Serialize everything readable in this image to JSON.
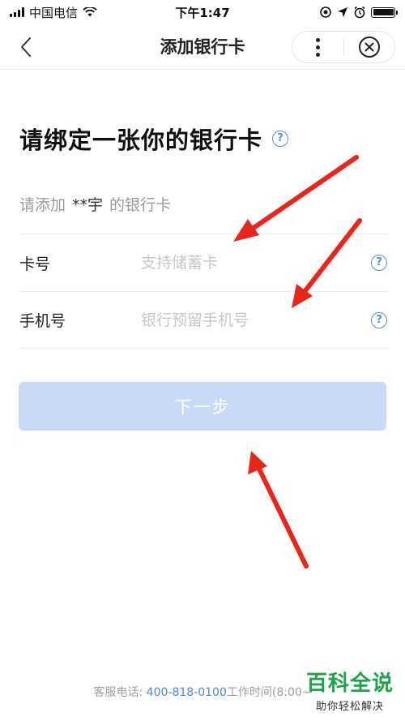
{
  "status_bar": {
    "carrier": "中国电信",
    "time": "下午1:47"
  },
  "nav": {
    "title": "添加银行卡"
  },
  "main": {
    "heading": "请绑定一张你的银行卡",
    "prompt_prefix": "请添加",
    "prompt_name": "**宇",
    "prompt_suffix": "的银行卡",
    "fields": [
      {
        "label": "卡号",
        "placeholder": "支持储蓄卡",
        "value": ""
      },
      {
        "label": "手机号",
        "placeholder": "银行预留手机号",
        "value": ""
      }
    ],
    "next_label": "下一步"
  },
  "footer": {
    "prefix": "客服电话: ",
    "phone": "400-818-0100",
    "suffix": "工作时间(8:00~"
  },
  "watermark": {
    "title": "百科全说",
    "subtitle": "助你轻松解决"
  },
  "colors": {
    "accent": "#5b8ed6",
    "button_disabled": "#c8daf8",
    "annotation_arrow": "#e8261c",
    "watermark": "#1fa34a"
  },
  "icons": [
    "signal-icon",
    "wifi-icon",
    "location-icon",
    "alarm-icon",
    "battery-icon",
    "back-icon",
    "more-icon",
    "close-icon",
    "help-icon"
  ]
}
